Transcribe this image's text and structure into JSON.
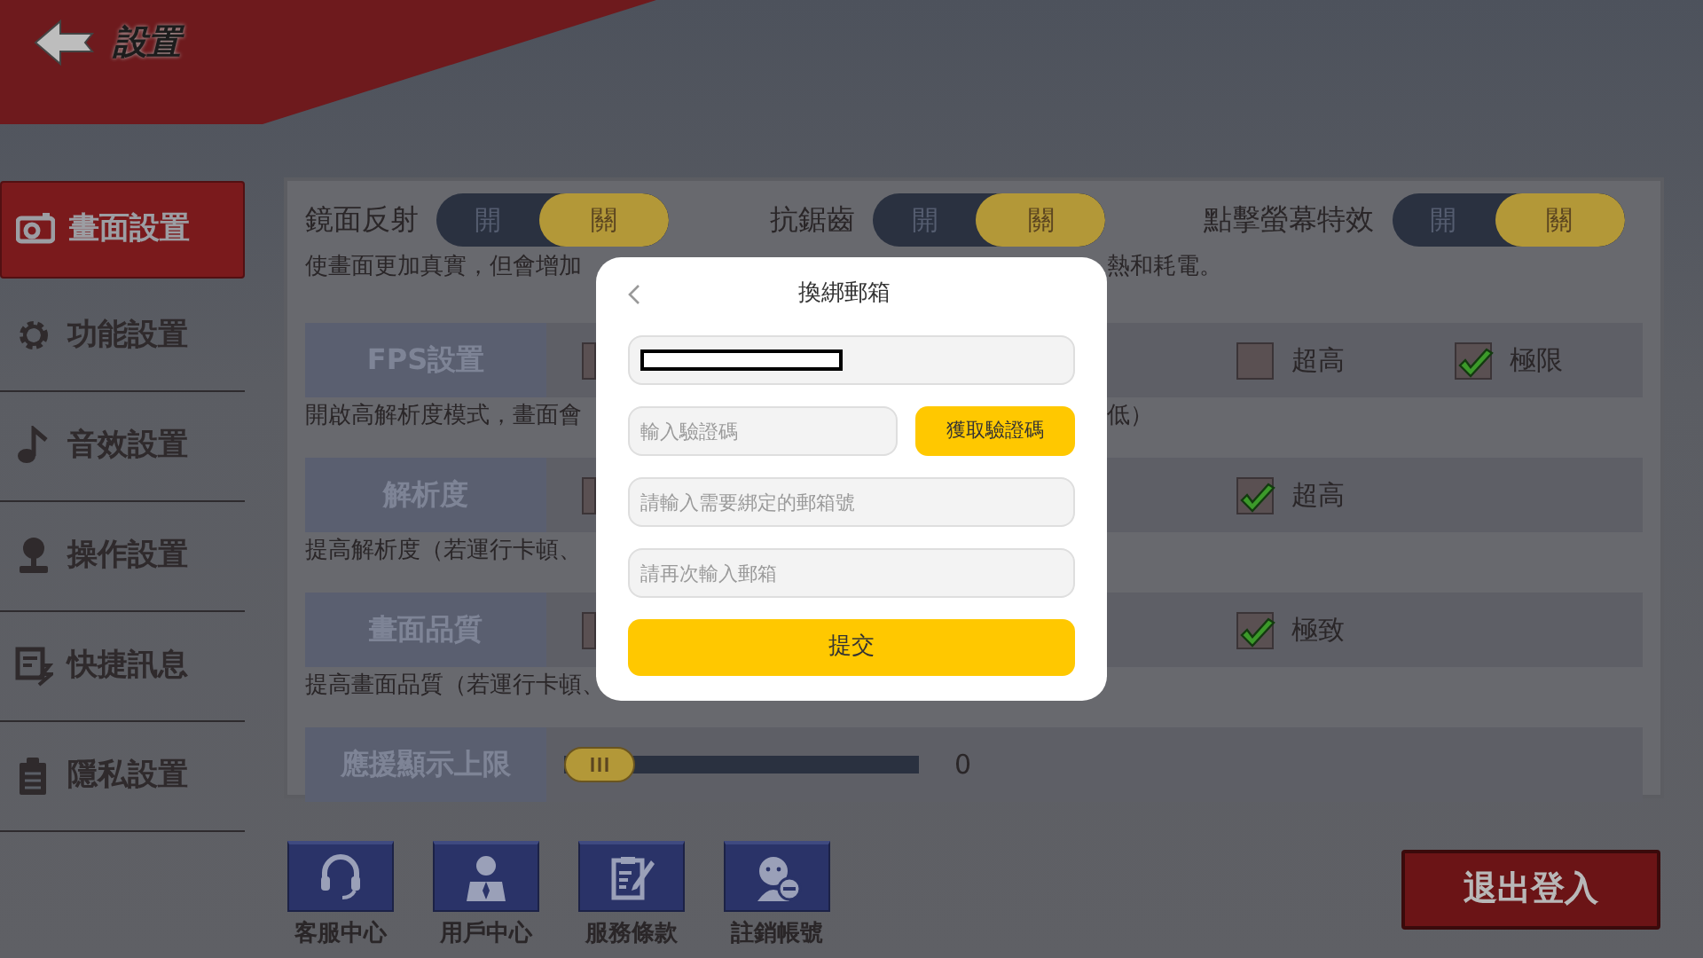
{
  "header": {
    "title": "設置"
  },
  "sidebar": {
    "items": [
      {
        "label": "畫面設置",
        "selected": true
      },
      {
        "label": "功能設置",
        "selected": false
      },
      {
        "label": "音效設置",
        "selected": false
      },
      {
        "label": "操作設置",
        "selected": false
      },
      {
        "label": "快捷訊息",
        "selected": false
      },
      {
        "label": "隱私設置",
        "selected": false
      }
    ]
  },
  "graphics": {
    "toggles": [
      {
        "label": "鏡面反射",
        "on": false,
        "on_text": "開",
        "off_text": "關"
      },
      {
        "label": "抗鋸齒",
        "on": false,
        "on_text": "開",
        "off_text": "關"
      },
      {
        "label": "點擊螢幕特效",
        "on": false,
        "on_text": "開",
        "off_text": "關"
      }
    ],
    "toggles_description": {
      "left": "使畫面更加真實，但會增加",
      "right": "熱和耗電。"
    },
    "settings": [
      {
        "label": "FPS設置",
        "options": [
          {
            "checked": false
          },
          {
            "label": "超高",
            "checked": false
          },
          {
            "label": "極限",
            "checked": true
          }
        ],
        "description": {
          "left": "開啟高解析度模式，畫面會",
          "right": "低）"
        }
      },
      {
        "label": "解析度",
        "options": [
          {
            "checked": false
          },
          {
            "label": "超高",
            "checked": true
          }
        ],
        "description": {
          "left": "提高解析度（若運行卡頓、"
        }
      },
      {
        "label": "畫面品質",
        "options": [
          {
            "checked": false
          },
          {
            "label": "極致",
            "checked": true
          }
        ],
        "description": {
          "left": "提高畫面品質（若運行卡頓、"
        }
      }
    ],
    "slider": {
      "label": "應援顯示上限",
      "level": 0,
      "reading": "0"
    }
  },
  "bottom_links": [
    {
      "label": "客服中心"
    },
    {
      "label": "用戶中心"
    },
    {
      "label": "服務條款"
    },
    {
      "label": "註銷帳號"
    }
  ],
  "logout_button": "退出登入",
  "dialog": {
    "title": "換綁郵箱",
    "fields": [
      {
        "kind": "redacted"
      },
      {
        "kind": "code",
        "placeholder": "輸入驗證碼",
        "button": "獲取驗證碼"
      },
      {
        "kind": "text",
        "placeholder": "請輸入需要綁定的郵箱號"
      },
      {
        "kind": "text",
        "placeholder": "請再次輸入郵箱"
      }
    ],
    "submit_button": "提交"
  }
}
